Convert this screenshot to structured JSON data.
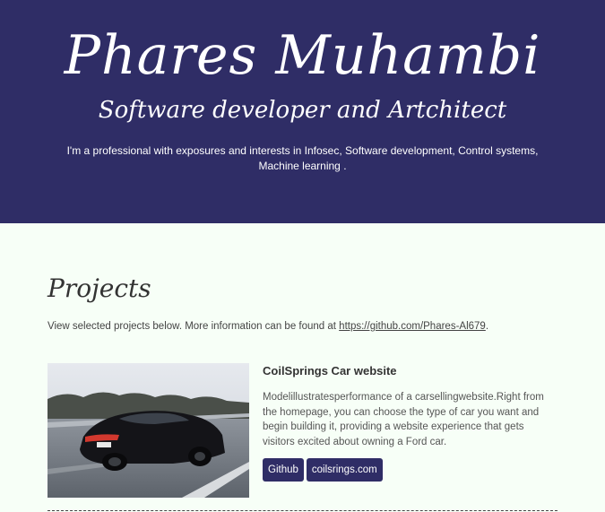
{
  "hero": {
    "name": "Phares Muhambi",
    "role": "Software developer and Artchitect",
    "bio": "I'm a professional with exposures and interests in Infosec, Software development, Control systems, Machine learning ."
  },
  "projects_section": {
    "title": "Projects",
    "intro_text": "View selected projects below. More information can be found at ",
    "intro_link": "https://github.com/Phares-Al679",
    "intro_suffix": "."
  },
  "projects": [
    {
      "title": "CoilSprings Car website",
      "description": "Modelillustratesperformance of a carsellingwebsite.Right from the homepage, you can choose the type of car you want and begin building it, providing a website experience that gets visitors excited about owning a Ford car.",
      "buttons": [
        "Github",
        "coilsrings.com"
      ]
    }
  ],
  "colors": {
    "hero_bg": "#2f2d66",
    "page_bg": "#f7fff7",
    "button_bg": "#2f2d66"
  }
}
